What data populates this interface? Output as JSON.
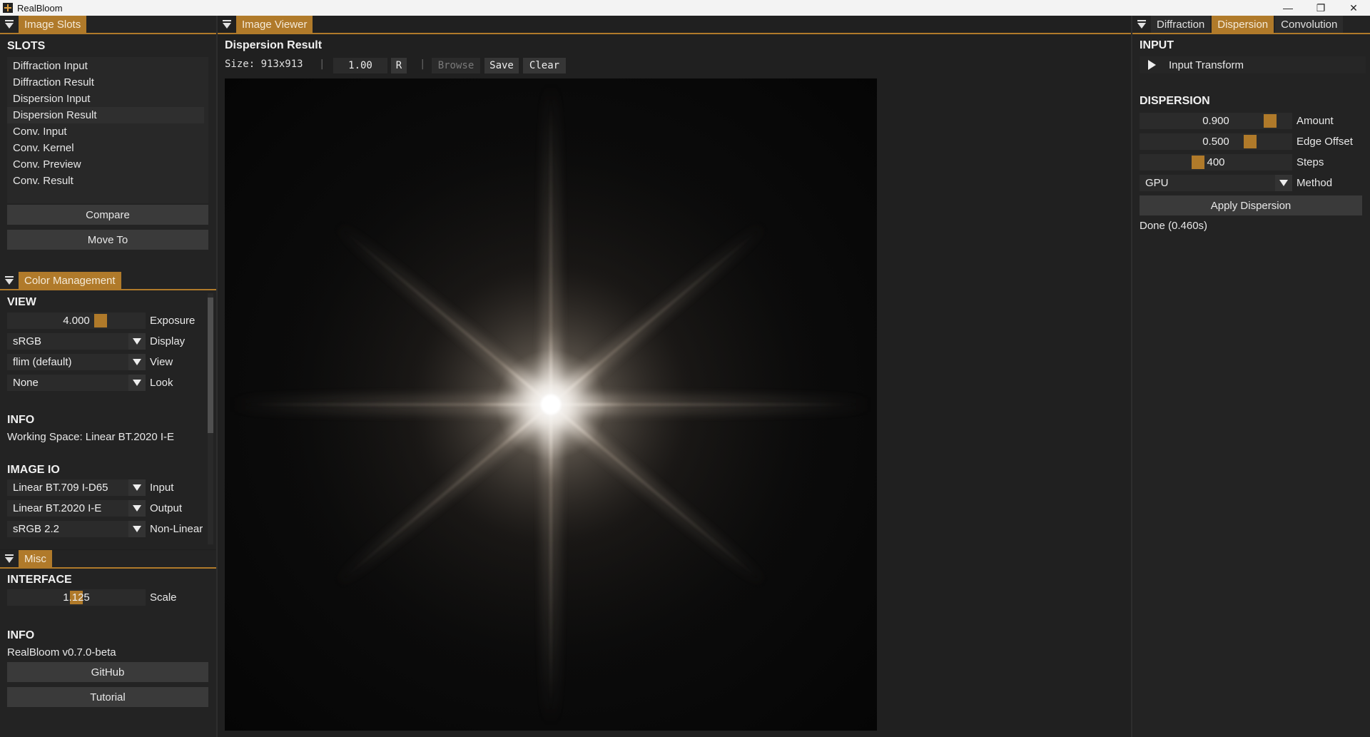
{
  "window": {
    "title": "RealBloom",
    "minimize": "—",
    "maximize": "❐",
    "close": "✕"
  },
  "image_slots": {
    "tab_label": "Image Slots",
    "section_title": "SLOTS",
    "slots": [
      "Diffraction Input",
      "Diffraction Result",
      "Dispersion Input",
      "Dispersion Result",
      "Conv. Input",
      "Conv. Kernel",
      "Conv. Preview",
      "Conv. Result"
    ],
    "selected_index": 3,
    "compare_label": "Compare",
    "move_to_label": "Move To"
  },
  "color_management": {
    "tab_label": "Color Management",
    "view_title": "VIEW",
    "exposure": {
      "value": "4.000",
      "label": "Exposure",
      "fraction": 0.6
    },
    "display": {
      "value": "sRGB",
      "label": "Display"
    },
    "view": {
      "value": "flim (default)",
      "label": "View"
    },
    "look": {
      "value": "None",
      "label": "Look"
    },
    "info_title": "INFO",
    "working_space": "Working Space: Linear BT.2020 I-E",
    "image_io_title": "IMAGE IO",
    "input": {
      "value": "Linear BT.709 I-D65",
      "label": "Input"
    },
    "output": {
      "value": "Linear BT.2020 I-E",
      "label": "Output"
    },
    "non_linear": {
      "value": "sRGB 2.2",
      "label": "Non-Linear"
    }
  },
  "misc": {
    "tab_label": "Misc",
    "interface_title": "INTERFACE",
    "scale": {
      "value": "1.125",
      "label": "Scale",
      "fraction": 0.5
    },
    "info_title": "INFO",
    "version": "RealBloom v0.7.0-beta",
    "github_label": "GitHub",
    "tutorial_label": "Tutorial"
  },
  "image_viewer": {
    "tab_label": "Image Viewer",
    "title": "Dispersion Result",
    "size_text": "Size: 913x913",
    "zoom": "1.00",
    "reset_label": "R",
    "browse_label": "Browse",
    "save_label": "Save",
    "clear_label": "Clear"
  },
  "right_panel": {
    "tabs": [
      "Diffraction",
      "Dispersion",
      "Convolution"
    ],
    "active_tab": 1,
    "input_title": "INPUT",
    "input_transform_label": "Input Transform",
    "dispersion_title": "DISPERSION",
    "amount": {
      "value": "0.900",
      "label": "Amount",
      "fraction": 0.9
    },
    "edge_offset": {
      "value": "0.500",
      "label": "Edge Offset",
      "fraction": 0.78
    },
    "steps": {
      "value": "400",
      "label": "Steps",
      "fraction": 0.4
    },
    "method": {
      "value": "GPU",
      "label": "Method"
    },
    "apply_label": "Apply Dispersion",
    "status": "Done (0.460s)"
  },
  "colors": {
    "accent": "#b07a2a",
    "panel": "#232323",
    "control": "#2b2b2b",
    "button": "#3a3a3a"
  },
  "icons": {
    "collapse": "collapse-triangle-icon",
    "expand": "play-triangle-icon",
    "dropdown": "chevron-down-icon"
  }
}
